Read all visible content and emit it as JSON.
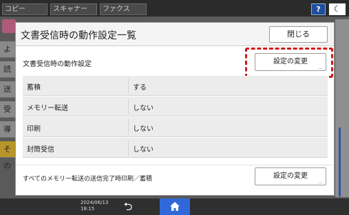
{
  "topbar": {
    "tabs": [
      "コピー",
      "スキャナー",
      "ファクス"
    ],
    "help_label": "?",
    "theme_label": "☾"
  },
  "background": {
    "sidebar_items": [
      "よく",
      "読み",
      "送信",
      "受信",
      "導入",
      "その"
    ]
  },
  "bottombar": {
    "date": "2024/06/13",
    "time": "18:15"
  },
  "modal": {
    "title": "文書受信時の動作設定一覧",
    "close_label": "閉じる",
    "section_label": "文書受信時の動作設定",
    "change_label": "設定の変更",
    "change_dots": "...",
    "rows": [
      {
        "key": "蓄積",
        "value": "する"
      },
      {
        "key": "メモリー転送",
        "value": "しない"
      },
      {
        "key": "印刷",
        "value": "しない"
      },
      {
        "key": "封筒受信",
        "value": "しない"
      }
    ],
    "bottom_label": "すべてのメモリー転送の送信完了時印刷／蓄積",
    "bottom_change_label": "設定の変更"
  },
  "colors": {
    "highlight": "#d01818",
    "home_accent": "#2f68d9",
    "help_bg": "#1f4f9a"
  },
  "icons": {
    "help": "question-icon",
    "theme": "moon-icon",
    "back": "back-arrow-icon",
    "home": "home-icon"
  }
}
